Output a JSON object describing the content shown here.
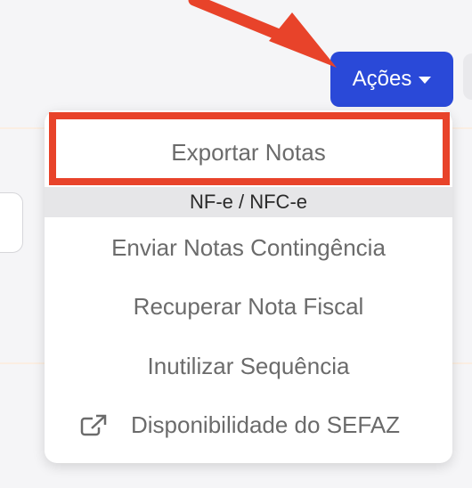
{
  "actions_button": {
    "label": "Ações"
  },
  "dropdown": {
    "export_label": "Exportar Notas",
    "section_header": "NF-e / NFC-e",
    "items": [
      "Enviar Notas Contingência",
      "Recuperar Nota Fiscal",
      "Inutilizar Sequência"
    ],
    "external_link_label": "Disponibilidade do SEFAZ"
  },
  "colors": {
    "accent": "#2a49d8",
    "annotation": "#e8432a",
    "menu_text": "#6b6b6b"
  },
  "icons": {
    "caret": "caret-down-icon",
    "external": "external-link-icon",
    "annotation_arrow": "arrow-icon"
  }
}
